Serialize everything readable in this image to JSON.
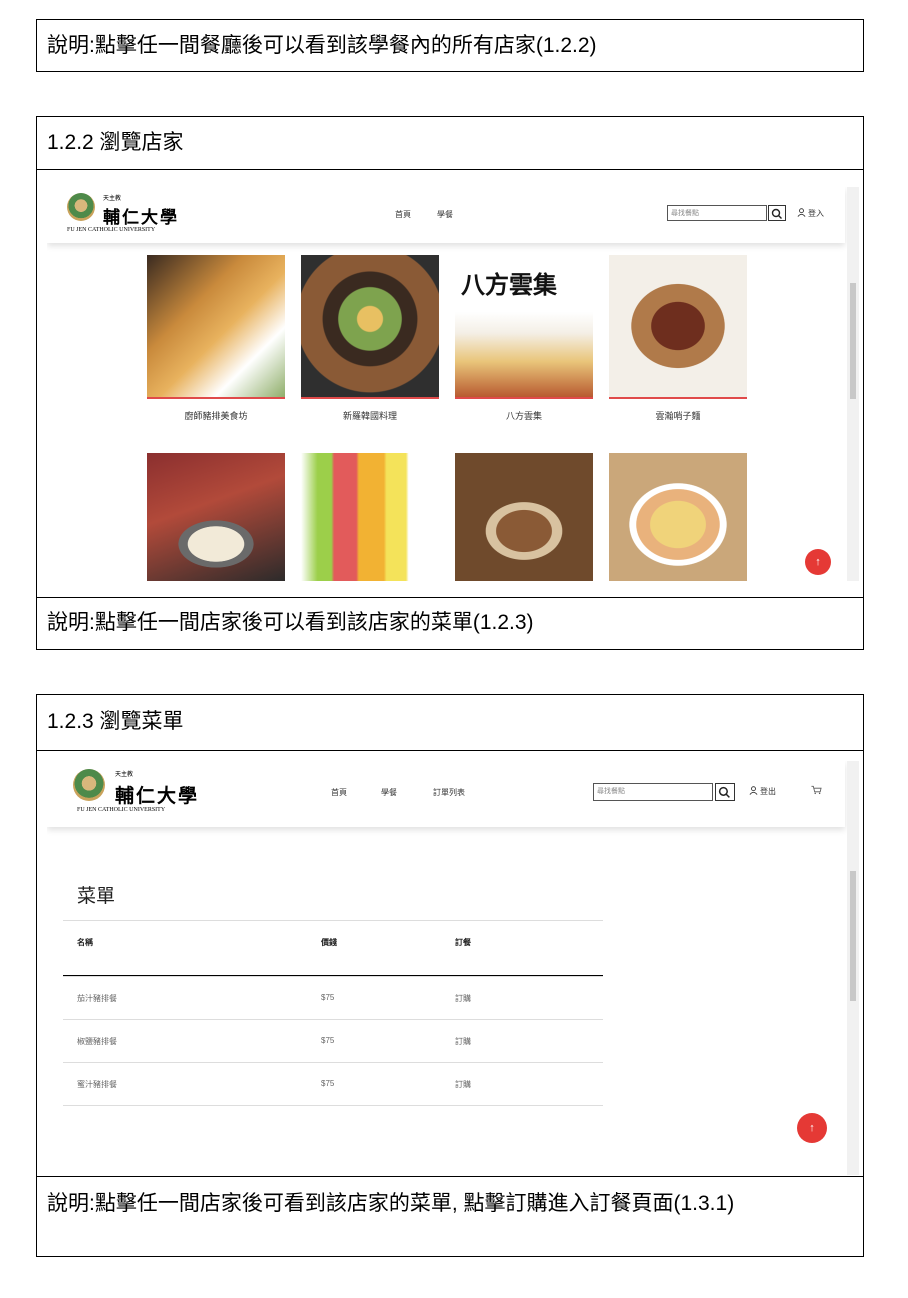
{
  "notes": {
    "top": "說明:點擊任一間餐廳後可以看到該學餐內的所有店家(1.2.2)",
    "sec2_foot": "說明:點擊任一間店家後可以看到該店家的菜單(1.2.3)",
    "sec3_foot": "說明:點擊任一間店家後可看到該店家的菜單, 點擊訂購進入訂餐頁面(1.3.1)"
  },
  "sections": {
    "browse_shops": "1.2.2 瀏覽店家",
    "browse_menu": "1.2.3 瀏覽菜單"
  },
  "site": {
    "logo_small": "天主教",
    "logo_name": "輔仁大學",
    "logo_eng": "FU JEN CATHOLIC UNIVERSITY",
    "search_placeholder": "尋找餐點"
  },
  "nav_shops": {
    "links": [
      "首頁",
      "學餐"
    ],
    "login": "登入"
  },
  "nav_menu": {
    "links": [
      "首頁",
      "學餐",
      "訂單列表"
    ],
    "logout": "登出"
  },
  "shops": [
    {
      "name": "廚師豬排美食坊",
      "color_a": "#c98a3c",
      "color_b": "#6b4a2a"
    },
    {
      "name": "新羅韓國料理",
      "color_a": "#8a5a36",
      "color_b": "#3a2a20"
    },
    {
      "name": "八方雲集",
      "color_a": "#e9c57a",
      "color_b": "#f4efe6"
    },
    {
      "name": "雲瀚哨子麵",
      "color_a": "#a9673a",
      "color_b": "#e7ddd0"
    }
  ],
  "shops_row2": [
    {
      "color_a": "#8b2f2f",
      "color_b": "#cfc7b8"
    },
    {
      "color_a": "#f2b233",
      "color_b": "#e25b5b"
    },
    {
      "color_a": "#6f4a2c",
      "color_b": "#2b211a"
    },
    {
      "color_a": "#f0d37a",
      "color_b": "#e9b27c"
    }
  ],
  "logo_banner": "八方雲集",
  "menu": {
    "title": "菜單",
    "headers": [
      "名稱",
      "價錢",
      "訂餐"
    ],
    "rows": [
      {
        "name": "茄汁豬排餐",
        "price": "$75",
        "action": "訂購"
      },
      {
        "name": "椒鹽豬排餐",
        "price": "$75",
        "action": "訂購"
      },
      {
        "name": "蜜汁豬排餐",
        "price": "$75",
        "action": "訂購"
      }
    ]
  },
  "fab_icon": "arrow-up-icon",
  "colors": {
    "accent": "#e53935"
  }
}
